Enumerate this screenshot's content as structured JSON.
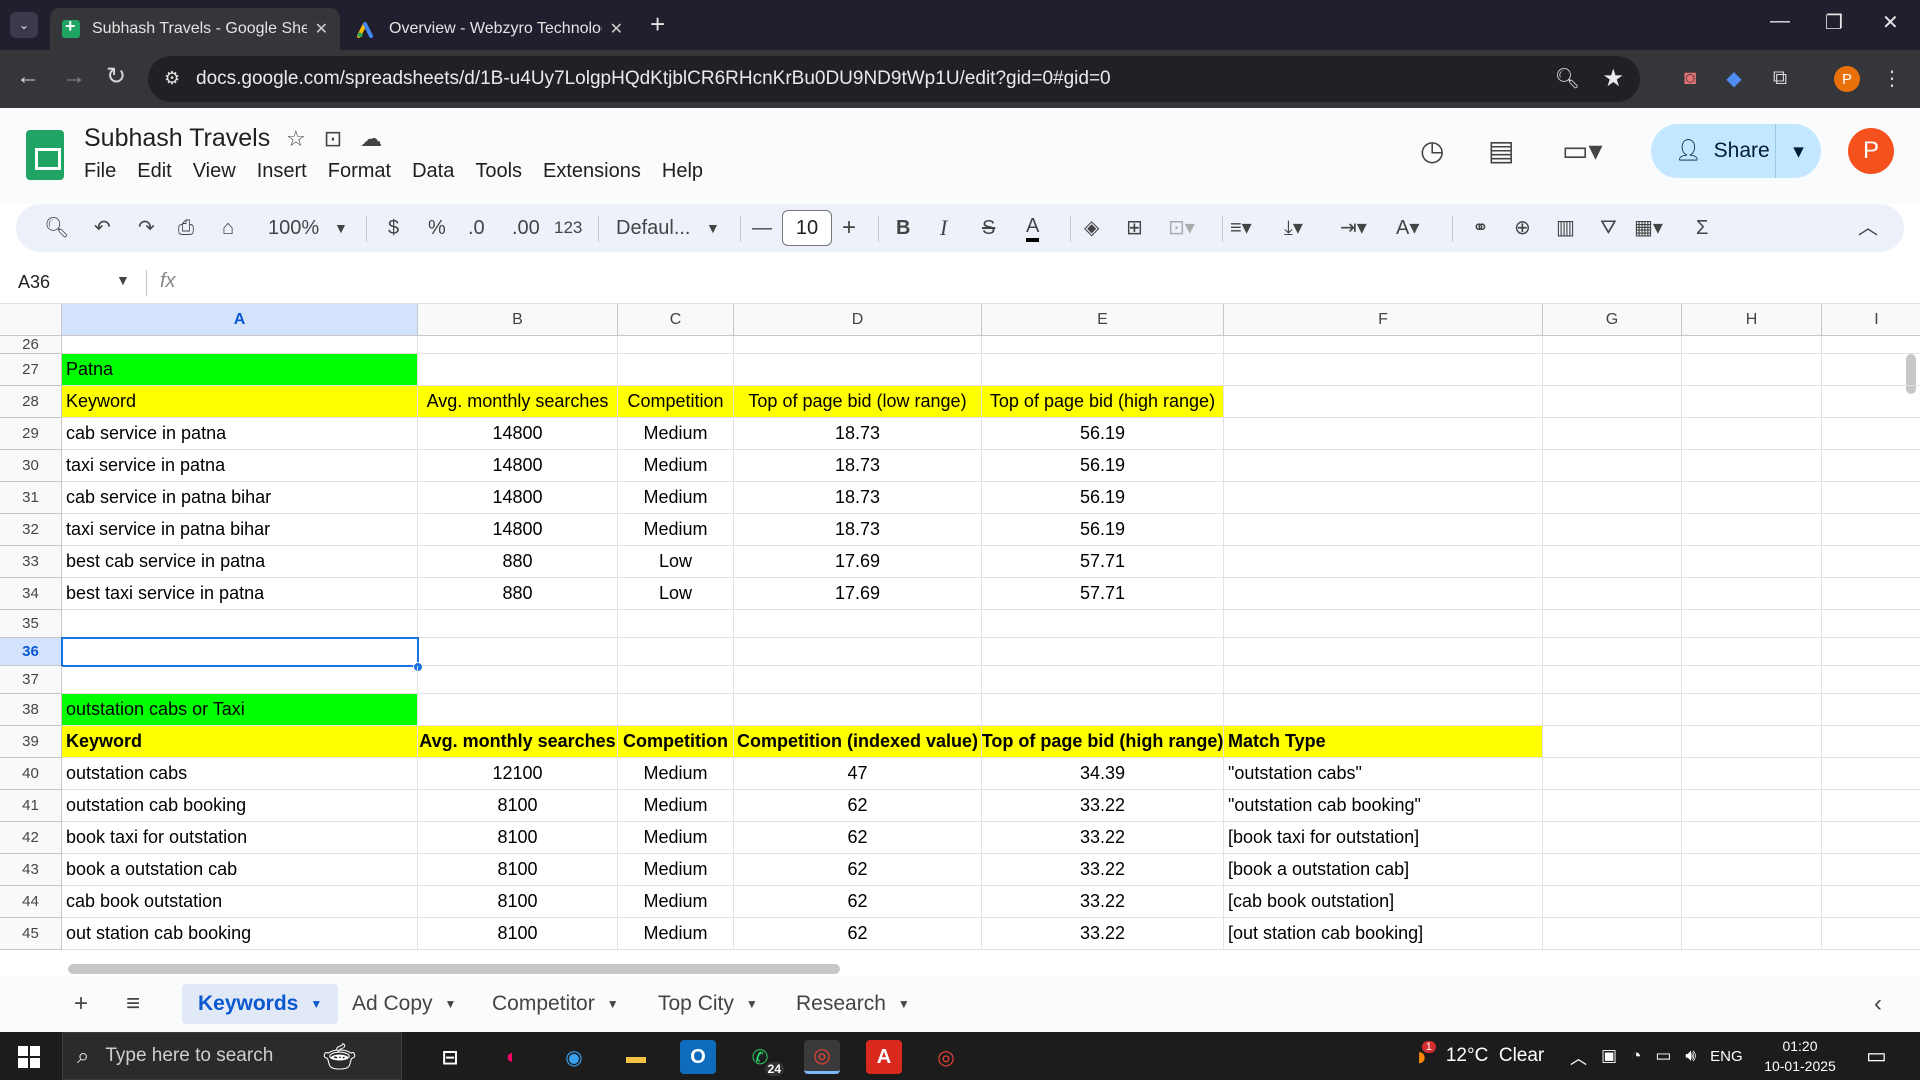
{
  "browser": {
    "tabs": [
      {
        "title": "Subhash Travels - Google Sheets",
        "active": true
      },
      {
        "title": "Overview - Webzyro Technologies",
        "active": false
      }
    ],
    "url": "docs.google.com/spreadsheets/d/1B-u4Uy7LolgpHQdKtjblCR6RHcnKrBu0DU9ND9tWp1U/edit?gid=0#gid=0",
    "profile_initial": "P"
  },
  "sheets": {
    "title": "Subhash Travels",
    "menu": [
      "File",
      "Edit",
      "View",
      "Insert",
      "Format",
      "Data",
      "Tools",
      "Extensions",
      "Help"
    ],
    "share_label": "Share",
    "avatar_initial": "P",
    "toolbar": {
      "zoom": "100%",
      "currency": "$",
      "percent": "%",
      "dec_decrease": ".0",
      "dec_increase": ".00",
      "number_format": "123",
      "font": "Defaul...",
      "font_size": "10"
    },
    "name_box": "A36",
    "fx": "fx"
  },
  "grid": {
    "columns": [
      "A",
      "B",
      "C",
      "D",
      "E",
      "F",
      "G",
      "H",
      "I"
    ],
    "selected_col": "A",
    "selected_cell": "A36",
    "rows": [
      {
        "num": "26",
        "cells": [
          "",
          "",
          "",
          "",
          "",
          ""
        ]
      },
      {
        "num": "27",
        "cells": [
          "Patna",
          "",
          "",
          "",
          "",
          ""
        ],
        "style": "title"
      },
      {
        "num": "28",
        "cells": [
          "Keyword",
          "Avg. monthly searches",
          "Competition",
          "Top of page bid (low range)",
          "Top of page bid (high range)",
          ""
        ],
        "style": "header"
      },
      {
        "num": "29",
        "cells": [
          "cab service in patna",
          "14800",
          "Medium",
          "18.73",
          "56.19",
          ""
        ]
      },
      {
        "num": "30",
        "cells": [
          "taxi service in patna",
          "14800",
          "Medium",
          "18.73",
          "56.19",
          ""
        ]
      },
      {
        "num": "31",
        "cells": [
          "cab service in patna bihar",
          "14800",
          "Medium",
          "18.73",
          "56.19",
          ""
        ]
      },
      {
        "num": "32",
        "cells": [
          "taxi service in patna bihar",
          "14800",
          "Medium",
          "18.73",
          "56.19",
          ""
        ]
      },
      {
        "num": "33",
        "cells": [
          "best cab service in patna",
          "880",
          "Low",
          "17.69",
          "57.71",
          ""
        ]
      },
      {
        "num": "34",
        "cells": [
          "best taxi service in patna",
          "880",
          "Low",
          "17.69",
          "57.71",
          ""
        ]
      },
      {
        "num": "35",
        "cells": [
          "",
          "",
          "",
          "",
          "",
          ""
        ]
      },
      {
        "num": "36",
        "cells": [
          "",
          "",
          "",
          "",
          "",
          ""
        ],
        "selected": true
      },
      {
        "num": "37",
        "cells": [
          "",
          "",
          "",
          "",
          "",
          ""
        ]
      },
      {
        "num": "38",
        "cells": [
          "outstation cabs or Taxi",
          "",
          "",
          "",
          "",
          ""
        ],
        "style": "title"
      },
      {
        "num": "39",
        "cells": [
          "Keyword",
          "Avg. monthly searches",
          "Competition",
          "Competition (indexed value)",
          "Top of page bid (high range)",
          "Match Type"
        ],
        "style": "header2"
      },
      {
        "num": "40",
        "cells": [
          "outstation cabs",
          "12100",
          "Medium",
          "47",
          "34.39",
          "\"outstation cabs\""
        ]
      },
      {
        "num": "41",
        "cells": [
          "outstation cab booking",
          "8100",
          "Medium",
          "62",
          "33.22",
          "\"outstation cab booking\""
        ]
      },
      {
        "num": "42",
        "cells": [
          "book taxi for outstation",
          "8100",
          "Medium",
          "62",
          "33.22",
          "[book taxi for outstation]"
        ]
      },
      {
        "num": "43",
        "cells": [
          "book a outstation cab",
          "8100",
          "Medium",
          "62",
          "33.22",
          "[book a outstation cab]"
        ]
      },
      {
        "num": "44",
        "cells": [
          "cab book outstation",
          "8100",
          "Medium",
          "62",
          "33.22",
          "[cab book outstation]"
        ]
      },
      {
        "num": "45",
        "cells": [
          "out station cab booking",
          "8100",
          "Medium",
          "62",
          "33.22",
          "[out station cab booking]"
        ]
      }
    ]
  },
  "sheet_tabs": [
    {
      "label": "Keywords",
      "active": true
    },
    {
      "label": "Ad Copy",
      "active": false
    },
    {
      "label": "Competitor",
      "active": false
    },
    {
      "label": "Top City",
      "active": false
    },
    {
      "label": "Research",
      "active": false
    }
  ],
  "taskbar": {
    "search_placeholder": "Type here to search",
    "whatsapp_badge": "24",
    "weather_badge": "1",
    "weather": "12°C  Clear",
    "lang": "ENG",
    "time": "01:20",
    "date": "10-01-2025"
  },
  "colors": {
    "title_fill": "#00ff00",
    "header_fill": "#ffff00",
    "selection": "#1a73e8",
    "share_bg": "#c2e7ff"
  }
}
